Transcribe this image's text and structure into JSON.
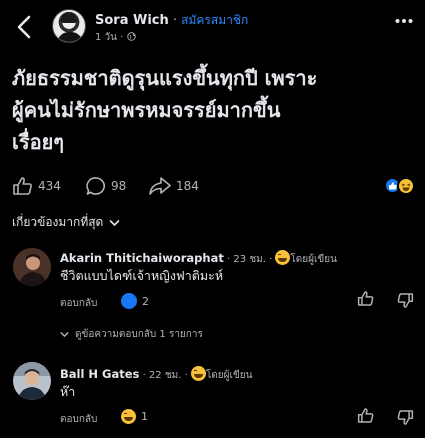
{
  "header": {
    "author": "Sora Wich",
    "separator": " · ",
    "badge": "สมัครสมาชิก",
    "time": "1 วัน",
    "meta_sep": " · "
  },
  "post": {
    "lines": [
      "ภัยธรรมชาติดูรุนแรงขึ้นทุกปี เพราะ",
      "ผู้คนไม่รักษาพรหมจรรย์มากขึ้น",
      "เรื่อยๆ"
    ]
  },
  "actions": {
    "likes": "434",
    "comments": "98",
    "shares": "184"
  },
  "sort": {
    "label": "เกี่ยวข้องมากที่สุด"
  },
  "comments": [
    {
      "name": "Akarin Thitichaiworaphat",
      "time": " · 23 ชม. · ",
      "badge": "โดยผู้เขียน",
      "text": "ชีวิตแบบไดฑ์เจ้าหญิงฟาติมะห์",
      "reply": "ตอบกลับ",
      "reaction_count": "2",
      "replies_link": "ดูข้อความตอบกลับ 1 รายการ"
    },
    {
      "name": "Ball H Gates",
      "time": " · 22 ชม. · ",
      "badge": "โดยผู้เขียน",
      "text": "ห๊า",
      "reply": "ตอบกลับ",
      "reaction_count": "1"
    }
  ],
  "colors": {
    "background": "#000000",
    "text": "#e4e6eb",
    "muted": "#b0b3b8",
    "accent": "#2d88ff",
    "like_blue": "#1877f2",
    "haha_yellow": "#f7c23a"
  },
  "icons": [
    "back-arrow-icon",
    "globe-icon",
    "more-icon",
    "like-icon",
    "comment-icon",
    "share-icon",
    "chevron-down-icon",
    "dislike-icon",
    "haha-emoji-icon"
  ]
}
